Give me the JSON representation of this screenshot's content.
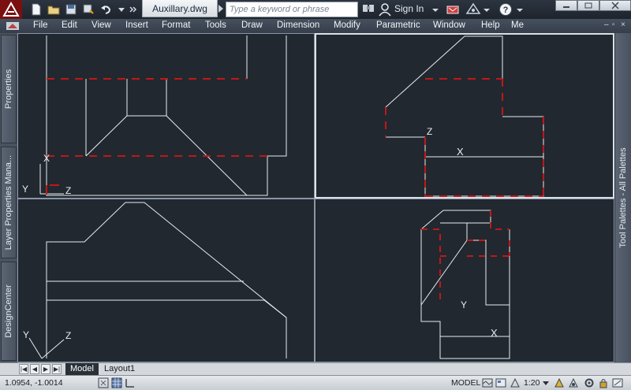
{
  "titlebar": {
    "file_name": "Auxillary.dwg",
    "search_placeholder": "Type a keyword or phrase",
    "sign_in": "Sign In"
  },
  "menu": [
    "File",
    "Edit",
    "View",
    "Insert",
    "Format",
    "Tools",
    "Draw",
    "Dimension",
    "Modify",
    "Parametric",
    "Window",
    "Help",
    "Me"
  ],
  "palettes": {
    "left": [
      "Properties",
      "Layer Properties Mana...",
      "DesignCenter"
    ],
    "right": "Tool Palettes - All Palettes"
  },
  "viewports": {
    "ucs_labels": {
      "x": "X",
      "y": "Y",
      "z": "Z"
    }
  },
  "tabs": [
    "Model",
    "Layout1"
  ],
  "status": {
    "coordinates": "1.0954, -1.0014",
    "space": "MODEL",
    "scale": "1:20"
  },
  "colors": {
    "geometry": "#e8ecf0",
    "hidden": "#c01818",
    "background": "#212830"
  },
  "icons": {
    "logo": "autocad-logo-icon",
    "new": "new-file-icon",
    "open": "open-folder-icon",
    "save": "save-icon",
    "saveas": "save-as-icon",
    "undo": "undo-icon",
    "user": "user-icon",
    "help": "help-icon"
  }
}
